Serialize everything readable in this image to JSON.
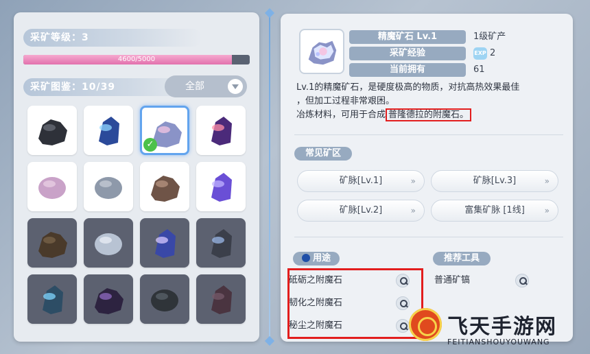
{
  "left": {
    "level_label": "采矿等级：",
    "level_value": "3",
    "progress_text": "4600/5000",
    "progress_fraction": 0.92,
    "codex_label": "采矿图鉴：",
    "codex_value": "10/39",
    "filter_label": "全部",
    "ores": [
      {
        "name": "black-ore",
        "color": "#2e3139",
        "accent": "#6a6e78",
        "state": "owned"
      },
      {
        "name": "blue-crystal-ore",
        "color": "#2b4a9a",
        "accent": "#8fd6ff",
        "state": "owned"
      },
      {
        "name": "fine-magic-ore",
        "color": "#8a93c7",
        "accent": "#f4c6e3",
        "state": "selected"
      },
      {
        "name": "purple-crystal-ore",
        "color": "#4b2a7a",
        "accent": "#ff8fa8",
        "state": "owned"
      },
      {
        "name": "pink-stone",
        "color": "#c9a2c8",
        "accent": "#e8cfe4",
        "state": "owned"
      },
      {
        "name": "gray-stone",
        "color": "#8e99aa",
        "accent": "#c5ccd6",
        "state": "owned"
      },
      {
        "name": "brown-ore",
        "color": "#6f5447",
        "accent": "#b79480",
        "state": "owned"
      },
      {
        "name": "violet-crystal",
        "color": "#6a4fd6",
        "accent": "#c0b2ff",
        "state": "owned"
      },
      {
        "name": "dark-brown-ore",
        "color": "#4a3a2a",
        "accent": "#7a6449",
        "state": "locked"
      },
      {
        "name": "silver-stone",
        "color": "#b8c3d3",
        "accent": "#e9eef5",
        "state": "locked"
      },
      {
        "name": "indigo-crystal",
        "color": "#3948a7",
        "accent": "#d7c8ff",
        "state": "locked"
      },
      {
        "name": "dark-crystal-ore",
        "color": "#3b3f4a",
        "accent": "#9bb8e8",
        "state": "locked"
      },
      {
        "name": "teal-crystal-ore",
        "color": "#2d4d65",
        "accent": "#7fd5ff",
        "state": "locked"
      },
      {
        "name": "dark-purple-ore",
        "color": "#2d2340",
        "accent": "#8f6bc2",
        "state": "locked"
      },
      {
        "name": "charcoal-stone",
        "color": "#2f3439",
        "accent": "#5a6169",
        "state": "locked"
      },
      {
        "name": "plum-stone",
        "color": "#4a3440",
        "accent": "#75596a",
        "state": "locked"
      }
    ]
  },
  "detail": {
    "name_label": "精魔矿石 Lv.1",
    "name_value": "1级矿产",
    "exp_label": "采矿经验",
    "exp_badge": "EXP",
    "exp_value": "2",
    "owned_label": "当前拥有",
    "owned_value": "61",
    "desc_line1": "Lv.1的精魔矿石，是硬度极高的物质，对抗高热效果最佳",
    "desc_line2": "，但加工过程非常艰困。",
    "desc_line3": "冶炼材料，可用于合成",
    "desc_highlight": "普隆德拉的附魔石。"
  },
  "regions": {
    "title": "常见矿区",
    "items": [
      "矿脉[Lv.1]",
      "矿脉[Lv.3]",
      "矿脉[Lv.2]",
      "富集矿脉 [1线]"
    ],
    "arrow": "»"
  },
  "uses": {
    "title": "用途",
    "items": [
      "砥砺之附魔石",
      "韧化之附魔石",
      "秘尘之附魔石"
    ]
  },
  "tools": {
    "title": "推荐工具",
    "items": [
      "普通矿镐"
    ]
  },
  "watermark": {
    "title": "飞天手游网",
    "subtitle": "FEITIANSHOUYOUWANG"
  }
}
